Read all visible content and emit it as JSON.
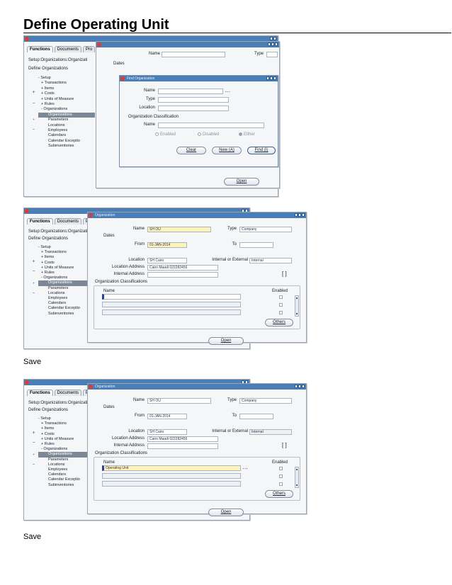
{
  "document": {
    "title": "Define Operating Unit",
    "save_label_1": "Save",
    "save_label_2": "Save"
  },
  "nav": {
    "tabs": [
      "Functions",
      "Documents",
      "Pro"
    ],
    "crumb": "Setup:Organizations:Organizati",
    "define": "Define Organizations",
    "tree": [
      "- Setup",
      "+ Transactions",
      "+ Items",
      "+ Costs",
      "+ Units of Measure",
      "+ Rules",
      "- Organizations",
      "Organizations",
      "Parameters",
      "Locations",
      "Employees",
      "Calendars",
      "Calendar Exceptio",
      "Subinventories"
    ]
  },
  "org": {
    "name_label": "Name",
    "type_label": "Type",
    "dates_label": "Dates",
    "from_label": "From",
    "to_label": "To",
    "location_label": "Location",
    "ie_label": "Internal or External",
    "loc_addr_label": "Location Address",
    "int_addr_label": "Internal Address",
    "class_label": "Organization Classifications",
    "col_name": "Name",
    "col_enabled": "Enabled",
    "others_label": "Others",
    "open_label": "Open",
    "bracket": "[ ]",
    "title": "Organization"
  },
  "find": {
    "title": "Find Organization",
    "name_label": "Name",
    "type_label": "Type",
    "location_label": "Location",
    "class_label": "Organization Classification",
    "class_name_label": "Name",
    "radio_enabled": "Enabled",
    "radio_disabled": "Disabled",
    "radio_either": "Either",
    "btn_clear": "Clear",
    "btn_new": "New (A)",
    "btn_find": "Find (I)"
  },
  "shot2": {
    "name": "SH OU",
    "type": "Company",
    "from": "01-JAN-2014",
    "location": "SH Cairo",
    "ie": "Internal",
    "loc_addr": "Cairo Maadi 022282456"
  },
  "shot3": {
    "name": "SH OU",
    "type": "Company",
    "from": "01-JAN-2014",
    "location": "SH Cairo",
    "ie": "Internal",
    "loc_addr": "Cairo Maadi 022282456",
    "class_value": "Operating Unit"
  },
  "colors": {
    "titlebar": "#4a7eb6",
    "highlight": "#fff4b8",
    "selected_row": "#7d8896"
  }
}
